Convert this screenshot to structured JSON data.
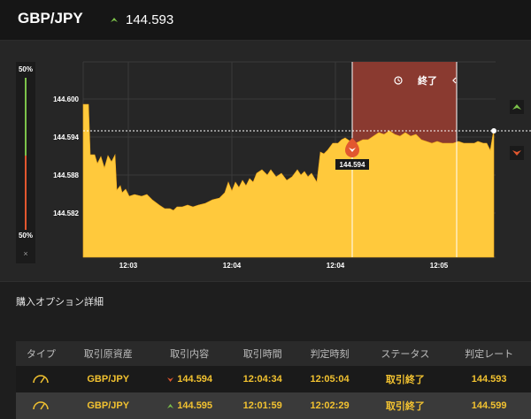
{
  "header": {
    "pair": "GBP/JPY",
    "price": "144.593",
    "trend_icon": "up-arrow-icon",
    "colors": {
      "up": "#7cc24a",
      "down": "#e2572f"
    }
  },
  "ratio": {
    "top_label": "50%",
    "bottom_label": "50%",
    "close_label": "×",
    "call_fraction": 0.5
  },
  "chart": {
    "y_ticks": [
      "144.600",
      "144.594",
      "144.588",
      "144.582"
    ],
    "x_ticks": [
      "12:03",
      "12:04",
      "12:04",
      "12:05"
    ],
    "expiry_label": "終了",
    "entry_label": "144.594",
    "fill_color": "#ffc93c",
    "expiry_color": "#8a3a30"
  },
  "side_buttons": {
    "up_icon": "up-arrow-icon",
    "down_icon": "down-arrow-icon"
  },
  "details": {
    "title": "購入オプション詳細",
    "columns": [
      "タイプ",
      "取引原資産",
      "取引内容",
      "取引時間",
      "判定時刻",
      "ステータス",
      "判定レート"
    ],
    "rows": [
      {
        "type_icon": "gauge-icon",
        "asset": "GBP/JPY",
        "direction": "down",
        "rate": "144.594",
        "trade_time": "12:04:34",
        "judge_time": "12:05:04",
        "status": "取引終了",
        "judge_rate": "144.593"
      },
      {
        "type_icon": "gauge-icon",
        "asset": "GBP/JPY",
        "direction": "up",
        "rate": "144.595",
        "trade_time": "12:01:59",
        "judge_time": "12:02:29",
        "status": "取引終了",
        "judge_rate": "144.599"
      }
    ]
  }
}
